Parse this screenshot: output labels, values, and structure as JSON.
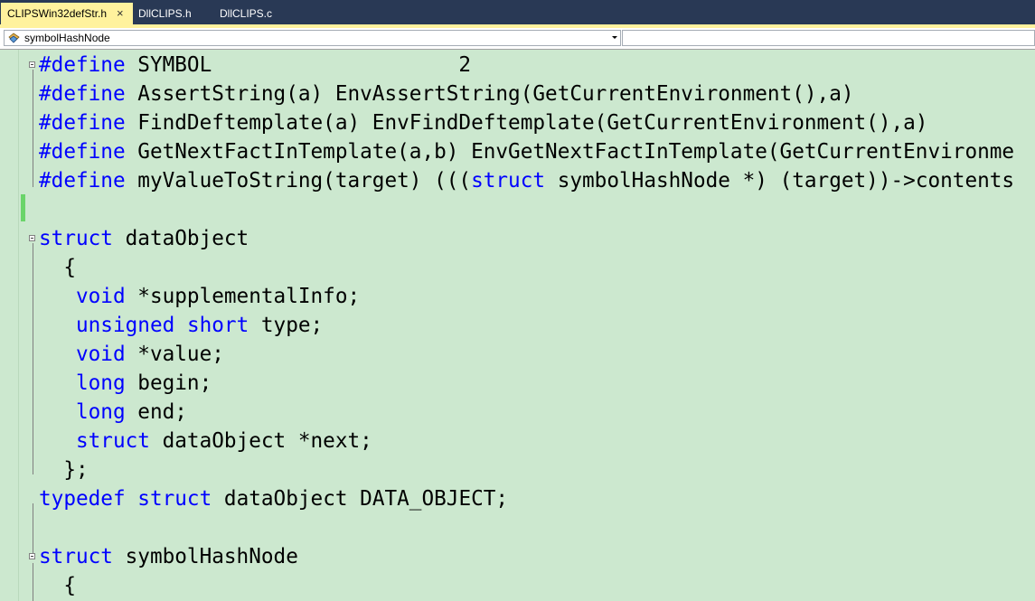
{
  "tabs": [
    {
      "label": "CLIPSWin32defStr.h",
      "active": true
    },
    {
      "label": "DllCLIPS.h",
      "active": false
    },
    {
      "label": "DllCLIPS.c",
      "active": false
    }
  ],
  "tab_close_glyph": "×",
  "navbar": {
    "scope_label": "symbolHashNode",
    "member_label": ""
  },
  "editor": {
    "background": "#cce8cf",
    "keyword_color": "#0000ff",
    "lines": [
      {
        "indent": "",
        "tokens": [
          {
            "t": "#define",
            "k": "pp"
          },
          {
            "t": " SYMBOL                    2"
          }
        ]
      },
      {
        "indent": "",
        "tokens": [
          {
            "t": "#define",
            "k": "pp"
          },
          {
            "t": " AssertString(a) EnvAssertString(GetCurrentEnvironment(),a)"
          }
        ]
      },
      {
        "indent": "",
        "tokens": [
          {
            "t": "#define",
            "k": "pp"
          },
          {
            "t": " FindDeftemplate(a) EnvFindDeftemplate(GetCurrentEnvironment(),a)"
          }
        ]
      },
      {
        "indent": "",
        "tokens": [
          {
            "t": "#define",
            "k": "pp"
          },
          {
            "t": " GetNextFactInTemplate(a,b) EnvGetNextFactInTemplate(GetCurrentEnvironme"
          }
        ]
      },
      {
        "indent": "",
        "tokens": [
          {
            "t": "#define",
            "k": "pp"
          },
          {
            "t": " myValueToString(target) ((("
          },
          {
            "t": "struct",
            "k": "kw"
          },
          {
            "t": " symbolHashNode *) (target))->contents"
          }
        ]
      },
      {
        "indent": "",
        "tokens": []
      },
      {
        "indent": "",
        "tokens": [
          {
            "t": "struct",
            "k": "kw"
          },
          {
            "t": " dataObject"
          }
        ]
      },
      {
        "indent": "  ",
        "tokens": [
          {
            "t": "{"
          }
        ]
      },
      {
        "indent": "   ",
        "tokens": [
          {
            "t": "void",
            "k": "kw"
          },
          {
            "t": " *supplementalInfo;"
          }
        ]
      },
      {
        "indent": "   ",
        "tokens": [
          {
            "t": "unsigned",
            "k": "kw"
          },
          {
            "t": " "
          },
          {
            "t": "short",
            "k": "kw"
          },
          {
            "t": " type;"
          }
        ]
      },
      {
        "indent": "   ",
        "tokens": [
          {
            "t": "void",
            "k": "kw"
          },
          {
            "t": " *value;"
          }
        ]
      },
      {
        "indent": "   ",
        "tokens": [
          {
            "t": "long",
            "k": "kw"
          },
          {
            "t": " begin;"
          }
        ]
      },
      {
        "indent": "   ",
        "tokens": [
          {
            "t": "long",
            "k": "kw"
          },
          {
            "t": " end;"
          }
        ]
      },
      {
        "indent": "   ",
        "tokens": [
          {
            "t": "struct",
            "k": "kw"
          },
          {
            "t": " dataObject *next;"
          }
        ]
      },
      {
        "indent": "  ",
        "tokens": [
          {
            "t": "};"
          }
        ]
      },
      {
        "indent": "",
        "tokens": [
          {
            "t": "typedef",
            "k": "kw"
          },
          {
            "t": " "
          },
          {
            "t": "struct",
            "k": "kw"
          },
          {
            "t": " dataObject DATA_OBJECT;"
          }
        ]
      },
      {
        "indent": "",
        "tokens": []
      },
      {
        "indent": "",
        "tokens": [
          {
            "t": "struct",
            "k": "kw"
          },
          {
            "t": " symbolHashNode"
          }
        ]
      },
      {
        "indent": "  ",
        "tokens": [
          {
            "t": "{"
          }
        ]
      }
    ]
  }
}
